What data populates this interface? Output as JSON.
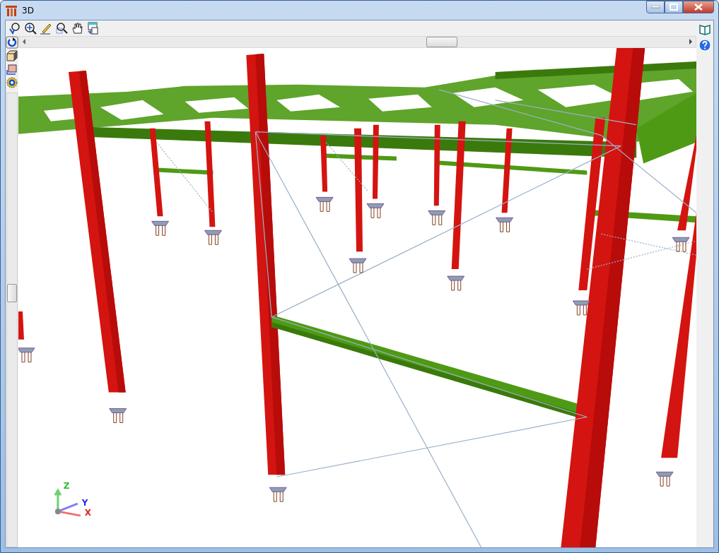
{
  "window": {
    "title": "3D"
  },
  "viewport": {
    "axis_labels": [
      {
        "kind": "z",
        "label": "Z"
      },
      {
        "kind": "y",
        "label": "Y"
      },
      {
        "kind": "x",
        "label": "X"
      }
    ]
  }
}
